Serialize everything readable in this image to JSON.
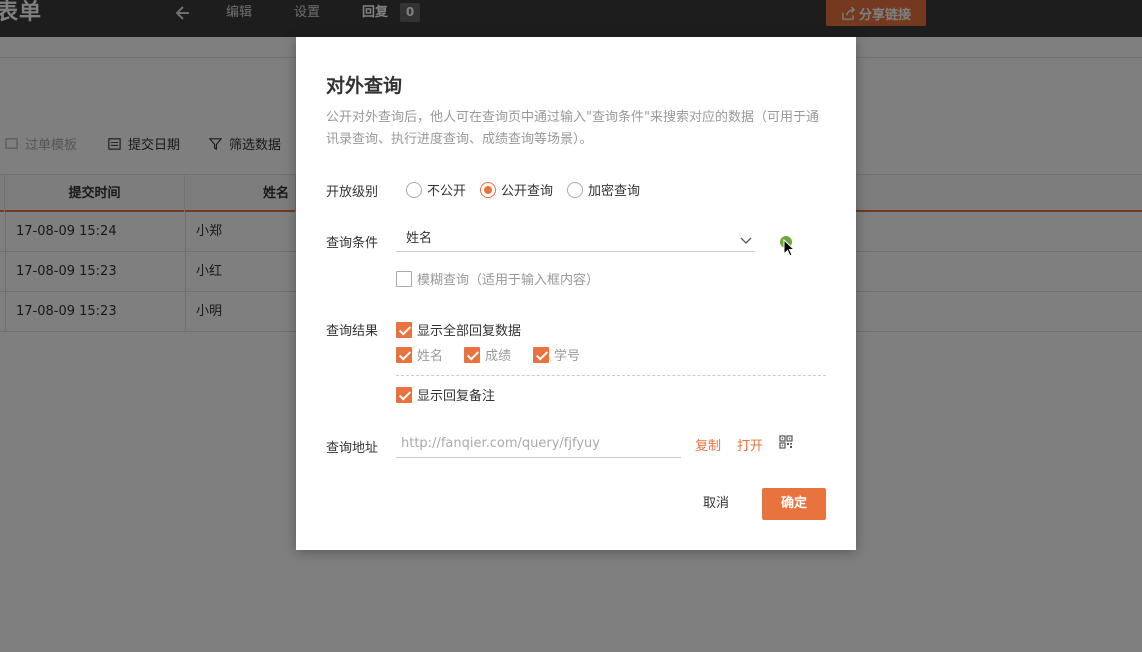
{
  "app": {
    "logo": "表单",
    "nav": {
      "edit": "编辑",
      "settings": "设置",
      "reply": "回复",
      "reply_count": "0"
    },
    "share_label": "分享链接"
  },
  "toolbar": {
    "template_label": "过单模板",
    "submit_date_label": "提交日期",
    "filter_label": "筛选数据"
  },
  "table": {
    "columns": [
      "提交时间",
      "姓名"
    ],
    "rows": [
      {
        "time": "17-08-09 15:24",
        "name": "小郑"
      },
      {
        "time": "17-08-09 15:23",
        "name": "小红"
      },
      {
        "time": "17-08-09 15:23",
        "name": "小明"
      }
    ]
  },
  "modal": {
    "title": "对外查询",
    "description": "公开对外查询后，他人可在查询页中通过输入\"查询条件\"来搜索对应的数据（可用于通讯录查询、执行进度查询、成绩查询等场景）。",
    "access_level": {
      "label": "开放级别",
      "options": [
        "不公开",
        "公开查询",
        "加密查询"
      ],
      "selected": "公开查询"
    },
    "query_condition": {
      "label": "查询条件",
      "value": "姓名",
      "fuzzy_label": "模糊查询（适用于输入框内容）"
    },
    "query_result": {
      "label": "查询结果",
      "show_all_label": "显示全部回复数据",
      "fields": [
        "姓名",
        "成绩",
        "学号"
      ],
      "show_notes_label": "显示回复备注"
    },
    "query_url": {
      "label": "查询地址",
      "placeholder": "http://fanqier.com/query/fjfyuy",
      "copy_label": "复制",
      "open_label": "打开"
    },
    "cancel_label": "取消",
    "confirm_label": "确定"
  },
  "colors": {
    "accent": "#e8733e",
    "topbar": "#3b3b3b",
    "add_green": "#6aaa3a"
  }
}
